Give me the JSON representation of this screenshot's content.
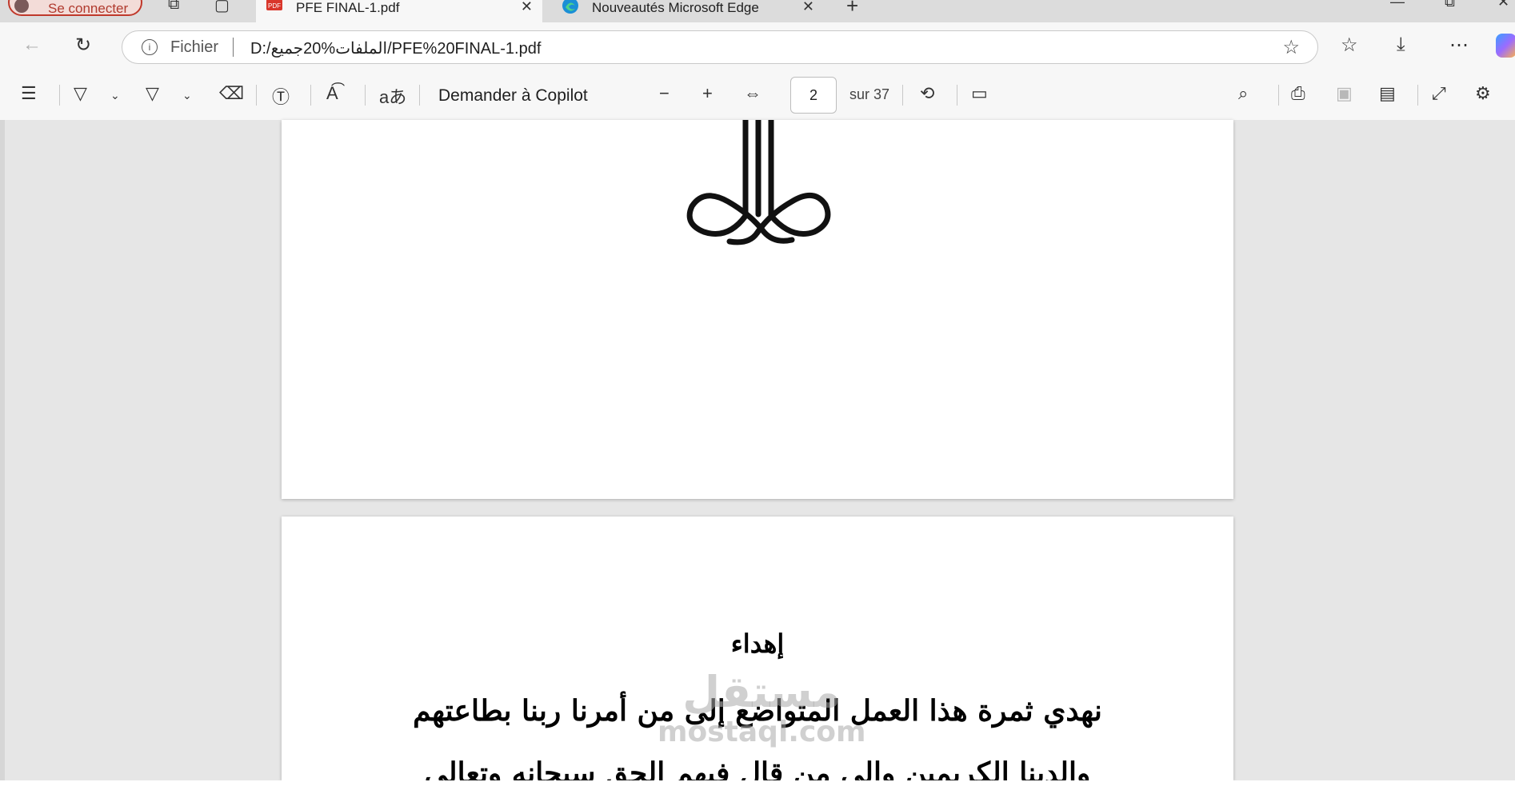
{
  "tabstrip": {
    "profile_label": "Se connecter",
    "tabs": [
      {
        "title": "PFE FINAL-1.pdf",
        "active": true,
        "icon": "pdf-icon"
      },
      {
        "title": "Nouveautés Microsoft Edge",
        "active": false,
        "icon": "edge-icon"
      }
    ]
  },
  "addressbar": {
    "scheme_label": "Fichier",
    "url": "D:/الملفات%20جميع/PFE%20FINAL-1.pdf"
  },
  "pdf_toolbar": {
    "copilot_label": "Demander à Copilot",
    "current_page": "2",
    "page_total": "sur 37"
  },
  "document": {
    "dedication_title": "إهداء",
    "lines": [
      "نهدي ثمرة هذا العمل المتواضع إلى من أمرنا ربنا بطاعتهم",
      "والدينا الكريمين والى من قال فيهم الحق سبحانه وتعالى"
    ]
  },
  "watermark": {
    "arabic": "مستقل",
    "latin": "mostaql.com"
  },
  "colors": {
    "chrome_bg": "#f7f7f7",
    "tabstrip_bg": "#dcdcdc",
    "viewer_bg": "#e6e6e6",
    "profile_accent": "#c0392b"
  }
}
